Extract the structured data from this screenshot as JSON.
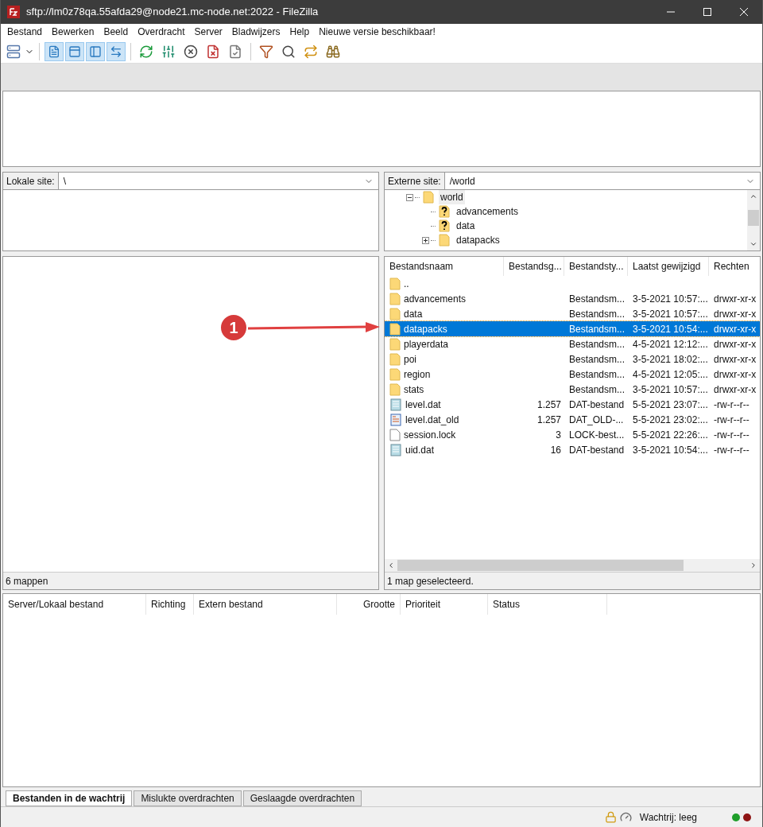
{
  "window": {
    "title": "sftp://lm0z78qa.55afda29@node21.mc-node.net:2022 - FileZilla"
  },
  "menu": [
    "Bestand",
    "Bewerken",
    "Beeld",
    "Overdracht",
    "Server",
    "Bladwijzers",
    "Help",
    "Nieuwe versie beschikbaar!"
  ],
  "toolbar": {
    "toggles": [
      {
        "pressed": true
      },
      {
        "pressed": true
      },
      {
        "pressed": true
      },
      {
        "pressed": true
      }
    ]
  },
  "local": {
    "label": "Lokale site:",
    "path": "\\",
    "status": "6 mappen"
  },
  "remote": {
    "label": "Externe site:",
    "path": "/world",
    "tree": [
      {
        "name": "world",
        "kind": "folder",
        "expanded": true,
        "selected": true,
        "children": [
          {
            "name": "advancements",
            "kind": "unknown",
            "selected": false
          },
          {
            "name": "data",
            "kind": "unknown",
            "selected": false
          },
          {
            "name": "datapacks",
            "kind": "folder",
            "expanded": false,
            "selected": false
          }
        ]
      }
    ],
    "columns": [
      "Bestandsnaam",
      "Bestandsg...",
      "Bestandsty...",
      "Laatst gewijzigd",
      "Rechten"
    ],
    "files": [
      {
        "name": "..",
        "kind": "folder",
        "selected": false
      },
      {
        "name": "advancements",
        "kind": "folder",
        "type": "Bestandsm...",
        "modified": "3-5-2021 10:57:...",
        "rights": "drwxr-xr-x",
        "selected": false
      },
      {
        "name": "data",
        "kind": "folder",
        "type": "Bestandsm...",
        "modified": "3-5-2021 10:57:...",
        "rights": "drwxr-xr-x",
        "selected": false
      },
      {
        "name": "datapacks",
        "kind": "folder",
        "type": "Bestandsm...",
        "modified": "3-5-2021 10:54:...",
        "rights": "drwxr-xr-x",
        "selected": true
      },
      {
        "name": "playerdata",
        "kind": "folder",
        "type": "Bestandsm...",
        "modified": "4-5-2021 12:12:...",
        "rights": "drwxr-xr-x",
        "selected": false
      },
      {
        "name": "poi",
        "kind": "folder",
        "type": "Bestandsm...",
        "modified": "3-5-2021 18:02:...",
        "rights": "drwxr-xr-x",
        "selected": false
      },
      {
        "name": "region",
        "kind": "folder",
        "type": "Bestandsm...",
        "modified": "4-5-2021 12:05:...",
        "rights": "drwxr-xr-x",
        "selected": false
      },
      {
        "name": "stats",
        "kind": "folder",
        "type": "Bestandsm...",
        "modified": "3-5-2021 10:57:...",
        "rights": "drwxr-xr-x",
        "selected": false
      },
      {
        "name": "level.dat",
        "kind": "data",
        "size": "1.257",
        "type": "DAT-bestand",
        "modified": "5-5-2021 23:07:...",
        "rights": "-rw-r--r--",
        "selected": false
      },
      {
        "name": "level.dat_old",
        "kind": "doc",
        "size": "1.257",
        "type": "DAT_OLD-...",
        "modified": "5-5-2021 23:02:...",
        "rights": "-rw-r--r--",
        "selected": false
      },
      {
        "name": "session.lock",
        "kind": "blank",
        "size": "3",
        "type": "LOCK-best...",
        "modified": "5-5-2021 22:26:...",
        "rights": "-rw-r--r--",
        "selected": false
      },
      {
        "name": "uid.dat",
        "kind": "data",
        "size": "16",
        "type": "DAT-bestand",
        "modified": "3-5-2021 10:54:...",
        "rights": "-rw-r--r--",
        "selected": false
      }
    ],
    "status": "1 map geselecteerd."
  },
  "annotation": {
    "label": "1"
  },
  "queue": {
    "columns": [
      "Server/Lokaal bestand",
      "Richting",
      "Extern bestand",
      "Grootte",
      "Prioriteit",
      "Status"
    ]
  },
  "queue_tabs": [
    {
      "label": "Bestanden in de wachtrij",
      "selected": true
    },
    {
      "label": "Mislukte overdrachten",
      "selected": false
    },
    {
      "label": "Geslaagde overdrachten",
      "selected": false
    }
  ],
  "status_bar": {
    "queue": "Wachtrij: leeg",
    "lights": [
      {
        "color": "#1e9e2a"
      },
      {
        "color": "#8e1414"
      }
    ]
  }
}
